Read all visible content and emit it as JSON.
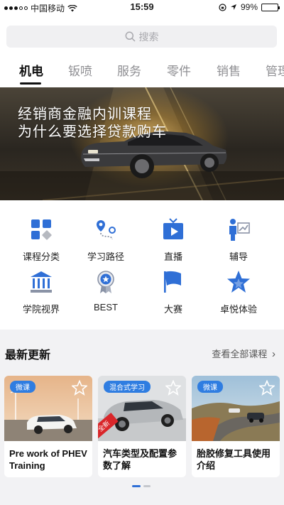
{
  "status_bar": {
    "carrier": "中国移动",
    "time": "15:59",
    "battery": "99%",
    "battery_level": 0.99
  },
  "search": {
    "placeholder": "搜索"
  },
  "tabs": [
    {
      "label": "机电",
      "active": true
    },
    {
      "label": "钣喷"
    },
    {
      "label": "服务"
    },
    {
      "label": "零件"
    },
    {
      "label": "销售"
    },
    {
      "label": "管理"
    }
  ],
  "banner": {
    "line1": "经销商金融内训课程",
    "line2": "为什么要选择贷款购车"
  },
  "grid": [
    {
      "label": "课程分类",
      "icon": "category-icon"
    },
    {
      "label": "学习路径",
      "icon": "path-icon"
    },
    {
      "label": "直播",
      "icon": "live-tv-icon"
    },
    {
      "label": "辅导",
      "icon": "coaching-icon"
    },
    {
      "label": "学院视界",
      "icon": "academy-icon"
    },
    {
      "label": "BEST",
      "icon": "medal-icon"
    },
    {
      "label": "大赛",
      "icon": "flag-icon"
    },
    {
      "label": "卓悦体验",
      "icon": "star-experience-icon"
    }
  ],
  "latest": {
    "title": "最新更新",
    "more": "查看全部课程",
    "cards": [
      {
        "tag": "微课",
        "title": "Pre work of PHEV Training"
      },
      {
        "tag": "混合式学习",
        "title": "汽车类型及配置参数了解",
        "ribbon": "全新"
      },
      {
        "tag": "微课",
        "title": "胎胶修复工具使用介绍"
      }
    ]
  },
  "colors": {
    "accent": "#2f6fd6",
    "tag_blue": "#2f7de1",
    "ribbon_red": "#d9262a"
  }
}
